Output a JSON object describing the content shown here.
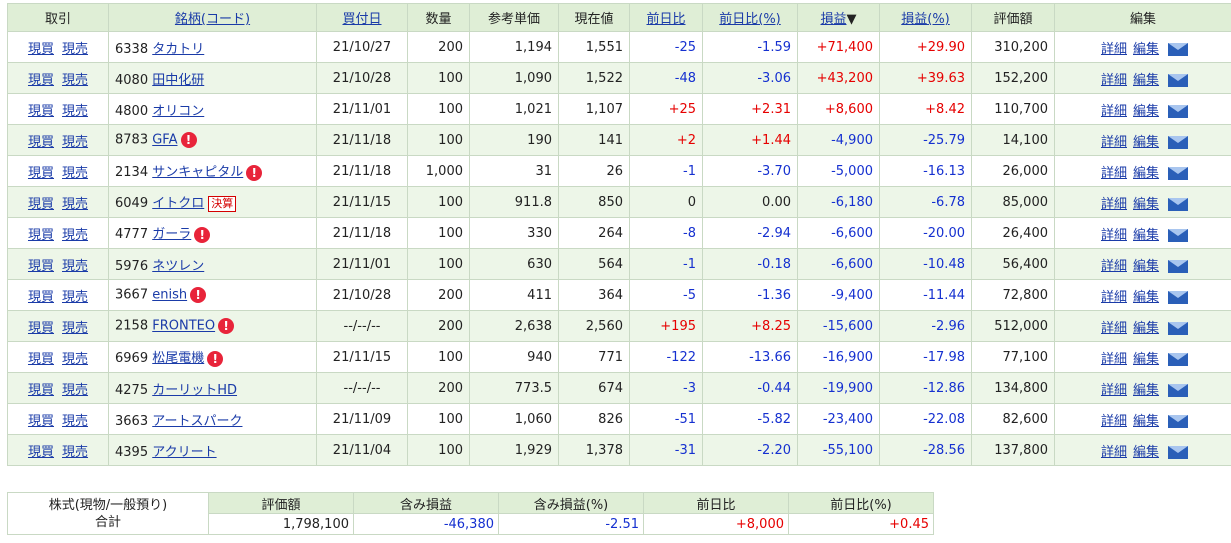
{
  "headers": {
    "trade": "取引",
    "name": "銘柄(コード)",
    "buy_date": "買付日",
    "qty": "数量",
    "ref_price": "参考単価",
    "price": "現在値",
    "change": "前日比",
    "change_pct": "前日比(%)",
    "pl": "損益",
    "pl_sort_mark": "▼",
    "pl_pct": "損益(%)",
    "value": "評価額",
    "edit": "編集"
  },
  "labels": {
    "buy": "現買",
    "sell": "現売",
    "detail": "詳細",
    "edit": "編集",
    "alert_mark": "!"
  },
  "colors": {
    "positive": "#e60000",
    "negative": "#1530d0",
    "header_bg": "#dfeed6",
    "row_alt_bg": "#edf6e8",
    "link": "#1a3ba8"
  },
  "rows": [
    {
      "code": "6338",
      "name": "タカトリ",
      "alert": false,
      "badge": "",
      "date": "21/10/27",
      "qty": "200",
      "ref": "1,194",
      "price": "1,551",
      "chg": "-25",
      "chg_pct": "-1.59",
      "pl": "+71,400",
      "pl_pct": "+29.90",
      "value": "310,200"
    },
    {
      "code": "4080",
      "name": "田中化研",
      "alert": false,
      "badge": "",
      "date": "21/10/28",
      "qty": "100",
      "ref": "1,090",
      "price": "1,522",
      "chg": "-48",
      "chg_pct": "-3.06",
      "pl": "+43,200",
      "pl_pct": "+39.63",
      "value": "152,200"
    },
    {
      "code": "4800",
      "name": "オリコン",
      "alert": false,
      "badge": "",
      "date": "21/11/01",
      "qty": "100",
      "ref": "1,021",
      "price": "1,107",
      "chg": "+25",
      "chg_pct": "+2.31",
      "pl": "+8,600",
      "pl_pct": "+8.42",
      "value": "110,700"
    },
    {
      "code": "8783",
      "name": "GFA",
      "alert": true,
      "badge": "",
      "date": "21/11/18",
      "qty": "100",
      "ref": "190",
      "price": "141",
      "chg": "+2",
      "chg_pct": "+1.44",
      "pl": "-4,900",
      "pl_pct": "-25.79",
      "value": "14,100"
    },
    {
      "code": "2134",
      "name": "サンキャピタル",
      "alert": true,
      "badge": "",
      "date": "21/11/18",
      "qty": "1,000",
      "ref": "31",
      "price": "26",
      "chg": "-1",
      "chg_pct": "-3.70",
      "pl": "-5,000",
      "pl_pct": "-16.13",
      "value": "26,000"
    },
    {
      "code": "6049",
      "name": "イトクロ",
      "alert": false,
      "badge": "決算",
      "date": "21/11/15",
      "qty": "100",
      "ref": "911.8",
      "price": "850",
      "chg": "0",
      "chg_pct": "0.00",
      "pl": "-6,180",
      "pl_pct": "-6.78",
      "value": "85,000"
    },
    {
      "code": "4777",
      "name": "ガーラ",
      "alert": true,
      "badge": "",
      "date": "21/11/18",
      "qty": "100",
      "ref": "330",
      "price": "264",
      "chg": "-8",
      "chg_pct": "-2.94",
      "pl": "-6,600",
      "pl_pct": "-20.00",
      "value": "26,400"
    },
    {
      "code": "5976",
      "name": "ネツレン",
      "alert": false,
      "badge": "",
      "date": "21/11/01",
      "qty": "100",
      "ref": "630",
      "price": "564",
      "chg": "-1",
      "chg_pct": "-0.18",
      "pl": "-6,600",
      "pl_pct": "-10.48",
      "value": "56,400"
    },
    {
      "code": "3667",
      "name": "enish",
      "alert": true,
      "badge": "",
      "date": "21/10/28",
      "qty": "200",
      "ref": "411",
      "price": "364",
      "chg": "-5",
      "chg_pct": "-1.36",
      "pl": "-9,400",
      "pl_pct": "-11.44",
      "value": "72,800"
    },
    {
      "code": "2158",
      "name": "FRONTEO",
      "alert": true,
      "badge": "",
      "date": "--/--/--",
      "qty": "200",
      "ref": "2,638",
      "price": "2,560",
      "chg": "+195",
      "chg_pct": "+8.25",
      "pl": "-15,600",
      "pl_pct": "-2.96",
      "value": "512,000"
    },
    {
      "code": "6969",
      "name": "松尾電機",
      "alert": true,
      "badge": "",
      "date": "21/11/15",
      "qty": "100",
      "ref": "940",
      "price": "771",
      "chg": "-122",
      "chg_pct": "-13.66",
      "pl": "-16,900",
      "pl_pct": "-17.98",
      "value": "77,100"
    },
    {
      "code": "4275",
      "name": "カーリットHD",
      "alert": false,
      "badge": "",
      "date": "--/--/--",
      "qty": "200",
      "ref": "773.5",
      "price": "674",
      "chg": "-3",
      "chg_pct": "-0.44",
      "pl": "-19,900",
      "pl_pct": "-12.86",
      "value": "134,800"
    },
    {
      "code": "3663",
      "name": "アートスパーク",
      "alert": false,
      "badge": "",
      "date": "21/11/09",
      "qty": "100",
      "ref": "1,060",
      "price": "826",
      "chg": "-51",
      "chg_pct": "-5.82",
      "pl": "-23,400",
      "pl_pct": "-22.08",
      "value": "82,600"
    },
    {
      "code": "4395",
      "name": "アクリート",
      "alert": false,
      "badge": "",
      "date": "21/11/04",
      "qty": "100",
      "ref": "1,929",
      "price": "1,378",
      "chg": "-31",
      "chg_pct": "-2.20",
      "pl": "-55,100",
      "pl_pct": "-28.56",
      "value": "137,800"
    }
  ],
  "summary": {
    "label_line1": "株式(現物/一般預り)",
    "label_line2": "合計",
    "headers": {
      "value": "評価額",
      "pl": "含み損益",
      "pl_pct": "含み損益(%)",
      "chg": "前日比",
      "chg_pct": "前日比(%)"
    },
    "values": {
      "value": "1,798,100",
      "pl": "-46,380",
      "pl_pct": "-2.51",
      "chg": "+8,000",
      "chg_pct": "+0.45"
    }
  }
}
